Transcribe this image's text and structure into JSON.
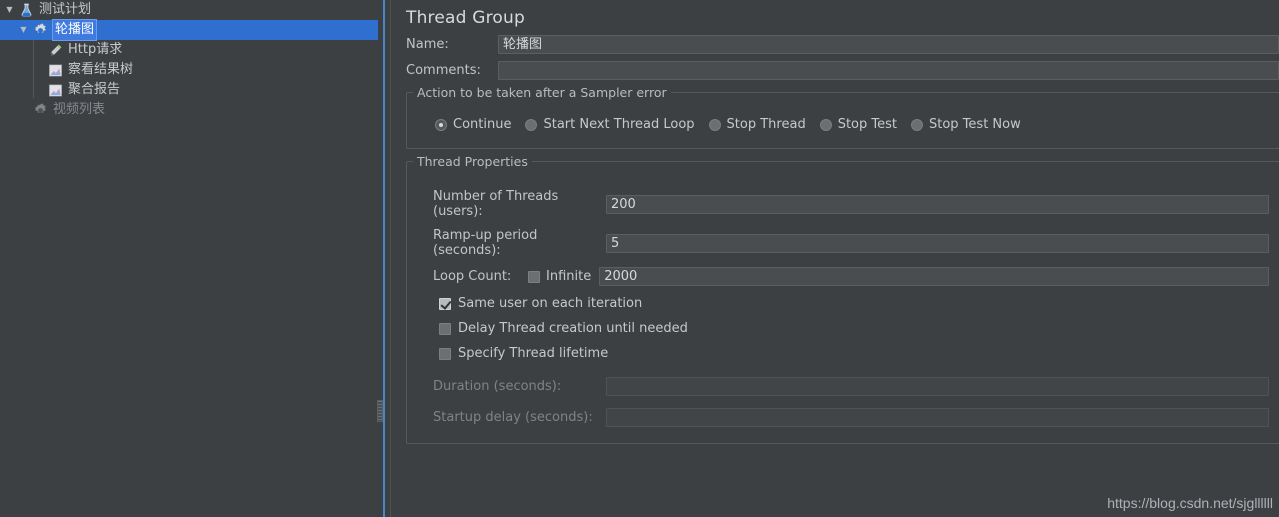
{
  "tree": {
    "items": [
      {
        "label": "测试计划",
        "icon": "flask-icon",
        "depth": 0,
        "twisty": "▼",
        "selected": false,
        "enabled": true
      },
      {
        "label": "轮播图",
        "icon": "gear-icon",
        "depth": 1,
        "twisty": "▼",
        "selected": true,
        "enabled": true
      },
      {
        "label": "Http请求",
        "icon": "pen-icon",
        "depth": 2,
        "twisty": "",
        "selected": false,
        "enabled": true
      },
      {
        "label": "察看结果树",
        "icon": "chart-icon",
        "depth": 2,
        "twisty": "",
        "selected": false,
        "enabled": true
      },
      {
        "label": "聚合报告",
        "icon": "chart-icon",
        "depth": 2,
        "twisty": "",
        "selected": false,
        "enabled": true
      },
      {
        "label": "视频列表",
        "icon": "gear-icon",
        "depth": 1,
        "twisty": "",
        "selected": false,
        "enabled": false
      }
    ]
  },
  "detail": {
    "title": "Thread Group",
    "name": {
      "label": "Name:",
      "value": "轮播图"
    },
    "comments": {
      "label": "Comments:",
      "value": ""
    },
    "sampler_error": {
      "title": "Action to be taken after a Sampler error",
      "options": [
        {
          "label": "Continue",
          "selected": true
        },
        {
          "label": "Start Next Thread Loop",
          "selected": false
        },
        {
          "label": "Stop Thread",
          "selected": false
        },
        {
          "label": "Stop Test",
          "selected": false
        },
        {
          "label": "Stop Test Now",
          "selected": false
        }
      ]
    },
    "thread_properties": {
      "title": "Thread Properties",
      "num_threads": {
        "label": "Number of Threads (users):",
        "value": "200"
      },
      "ramp_up": {
        "label": "Ramp-up period (seconds):",
        "value": "5"
      },
      "loop_count": {
        "label": "Loop Count:",
        "infinite_label": "Infinite",
        "infinite_checked": false,
        "value": "2000"
      },
      "checkboxes": [
        {
          "label": "Same user on each iteration",
          "checked": true
        },
        {
          "label": "Delay Thread creation until needed",
          "checked": false
        },
        {
          "label": "Specify Thread lifetime",
          "checked": false
        }
      ],
      "duration": {
        "label": "Duration (seconds):",
        "value": "",
        "enabled": false
      },
      "startup_delay": {
        "label": "Startup delay (seconds):",
        "value": "",
        "enabled": false
      }
    }
  },
  "watermark": "https://blog.csdn.net/sjgllllll",
  "colors": {
    "background": "#3c4043",
    "selection": "#2f6fd0",
    "splitter": "#4a87c9",
    "field": "#494d50"
  }
}
